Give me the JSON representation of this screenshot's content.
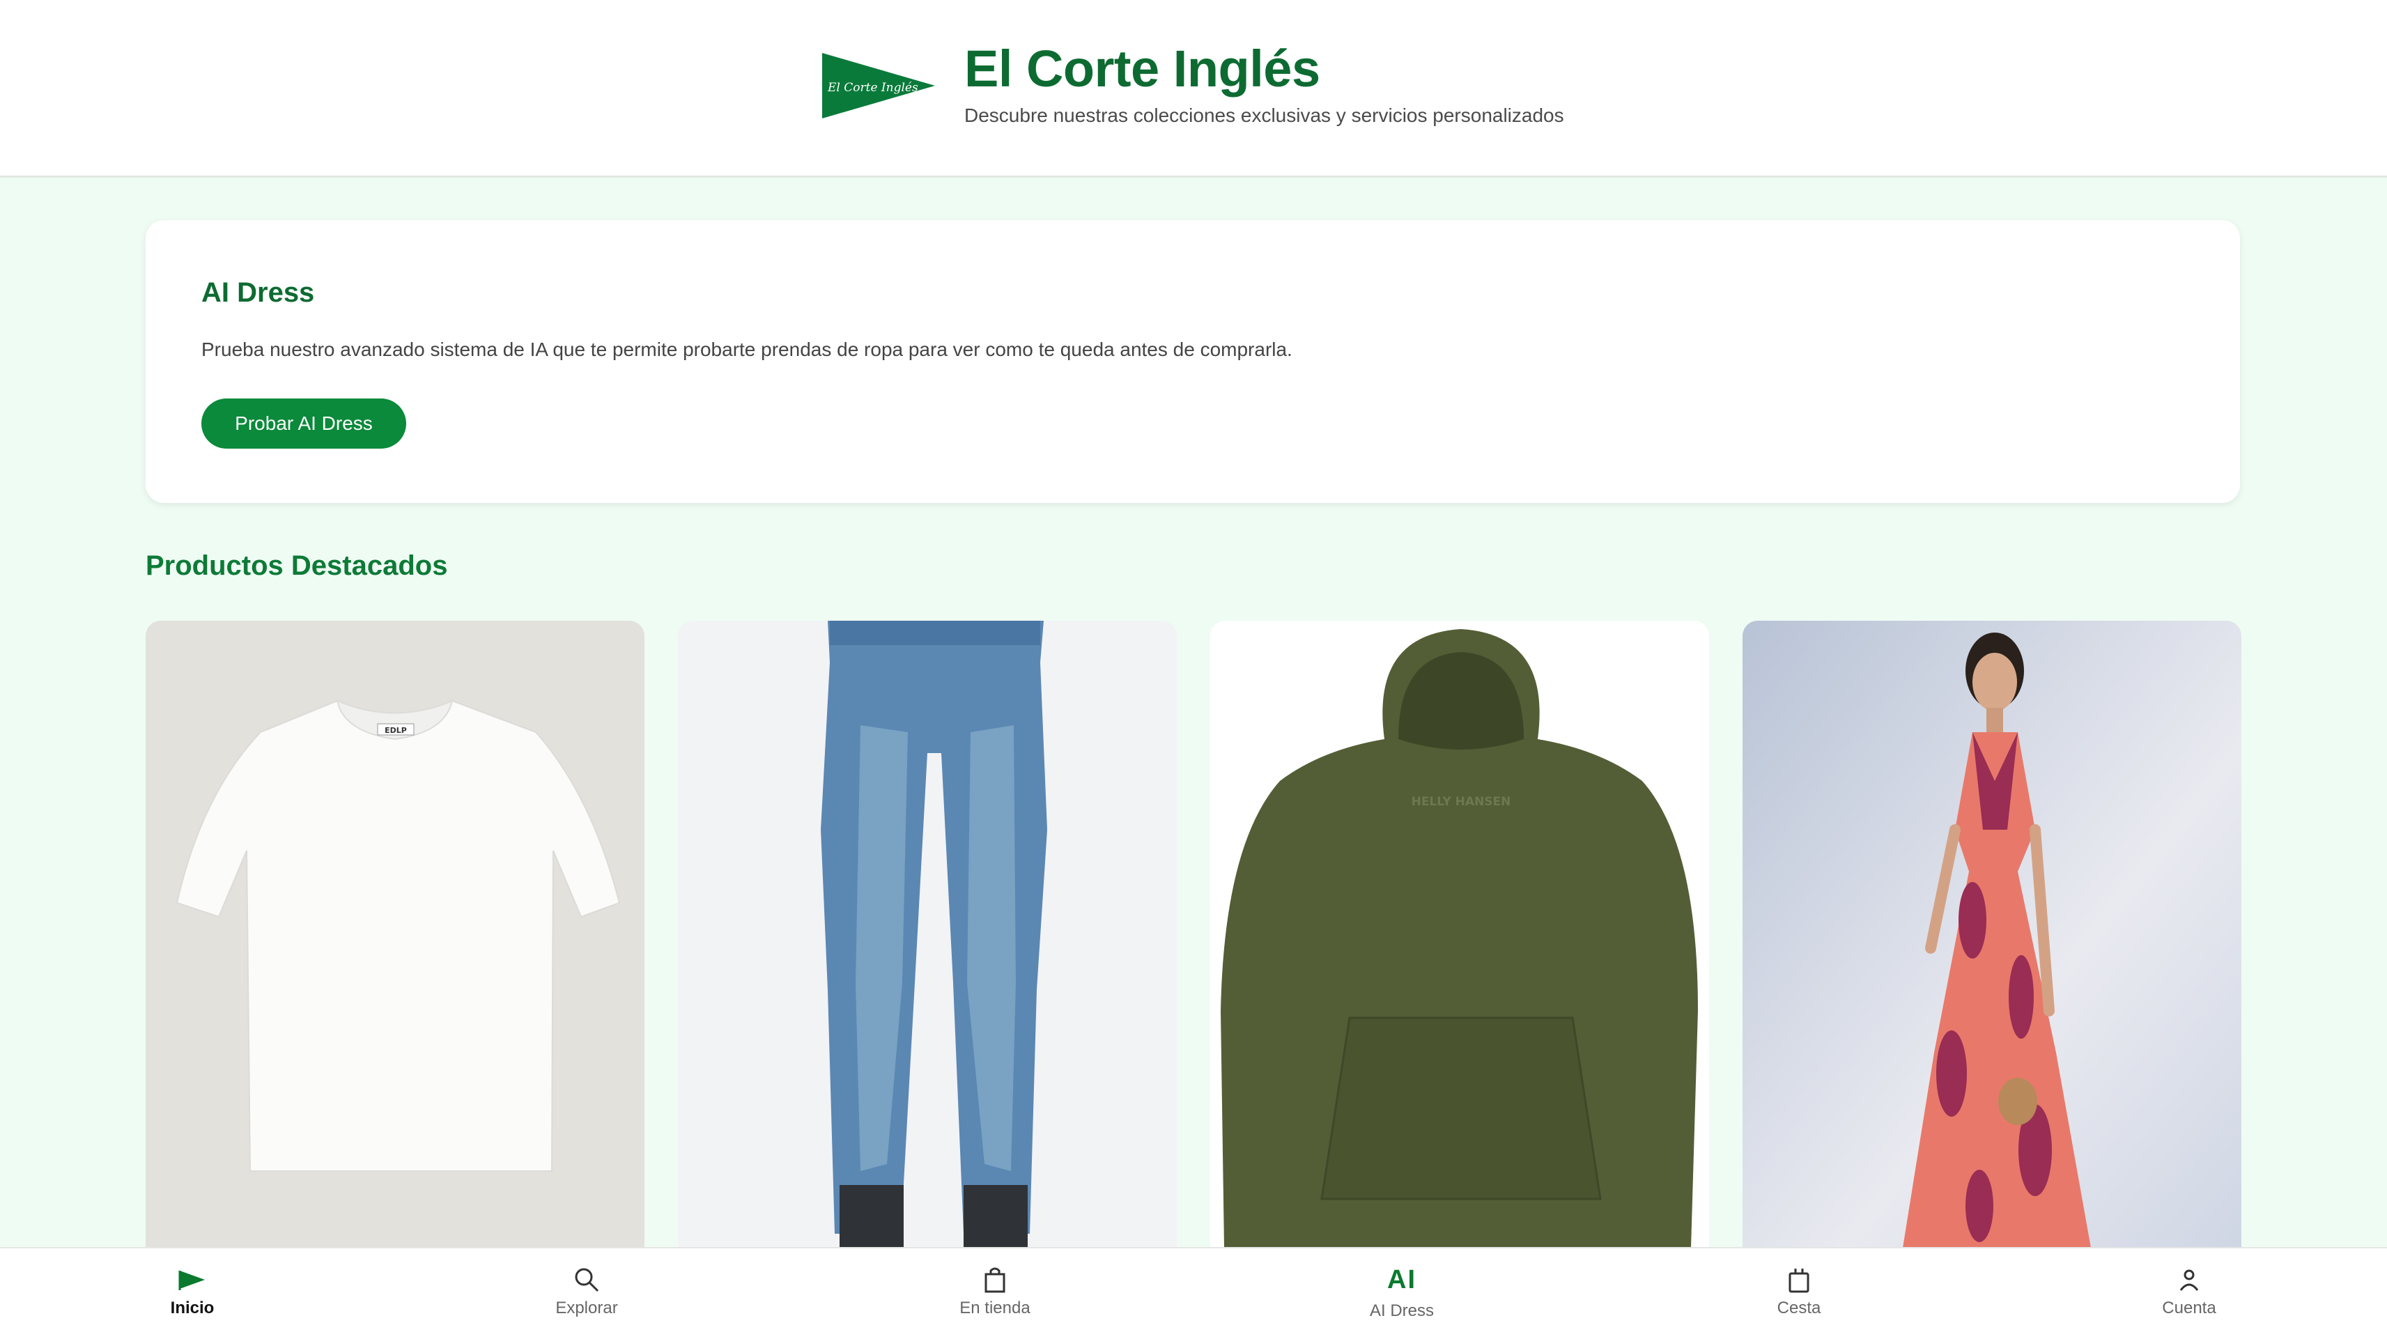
{
  "header": {
    "logo_text": "El Corte Inglés",
    "title": "El Corte Inglés",
    "subtitle": "Descubre nuestras colecciones exclusivas y servicios personalizados"
  },
  "ai_card": {
    "title": "AI Dress",
    "description": "Prueba nuestro avanzado sistema de IA que te permite probarte prendas de ropa para ver como te queda antes de comprarla.",
    "button_label": "Probar AI Dress"
  },
  "featured": {
    "title": "Productos Destacados",
    "products": [
      {
        "image": "white-tshirt",
        "tag_text": "EDLP"
      },
      {
        "image": "blue-jeans"
      },
      {
        "image": "green-hoodie",
        "print_text": "HELLY HANSEN"
      },
      {
        "image": "floral-dress"
      }
    ]
  },
  "nav": {
    "items": [
      {
        "label": "Inicio",
        "icon": "flag-icon",
        "active": true
      },
      {
        "label": "Explorar",
        "icon": "search-icon",
        "active": false
      },
      {
        "label": "En tienda",
        "icon": "shopping-bag-icon",
        "active": false
      },
      {
        "label": "AI Dress",
        "icon": "ai-icon",
        "icon_text": "AI",
        "active": false
      },
      {
        "label": "Cesta",
        "icon": "basket-icon",
        "active": false
      },
      {
        "label": "Cuenta",
        "icon": "user-icon",
        "active": false
      }
    ]
  },
  "colors": {
    "brand_green": "#0d6b32",
    "button_green": "#0a8a3a",
    "page_background": "#effcf4"
  }
}
